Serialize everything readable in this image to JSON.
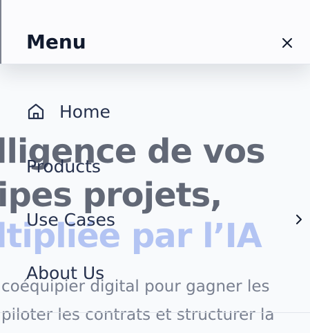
{
  "hero": {
    "line1": "lligence de vos",
    "line2": "ipes projets,",
    "line3": "ltipliée par l’IA",
    "sub1": "coéquipier digital pour gagner les",
    "sub2": "piloter les contrats et structurer la"
  },
  "menu": {
    "title": "Menu",
    "close_icon": "close-icon",
    "items": [
      {
        "label": "Home",
        "icon": "home-icon"
      },
      {
        "label": "Products"
      },
      {
        "label": "Use Cases",
        "trailing_icon": "chevron-right-icon"
      },
      {
        "label": "About Us"
      }
    ]
  },
  "colors": {
    "text_dark": "#111a2e",
    "menu_text": "#26314d",
    "accent": "#8ea7ee"
  }
}
